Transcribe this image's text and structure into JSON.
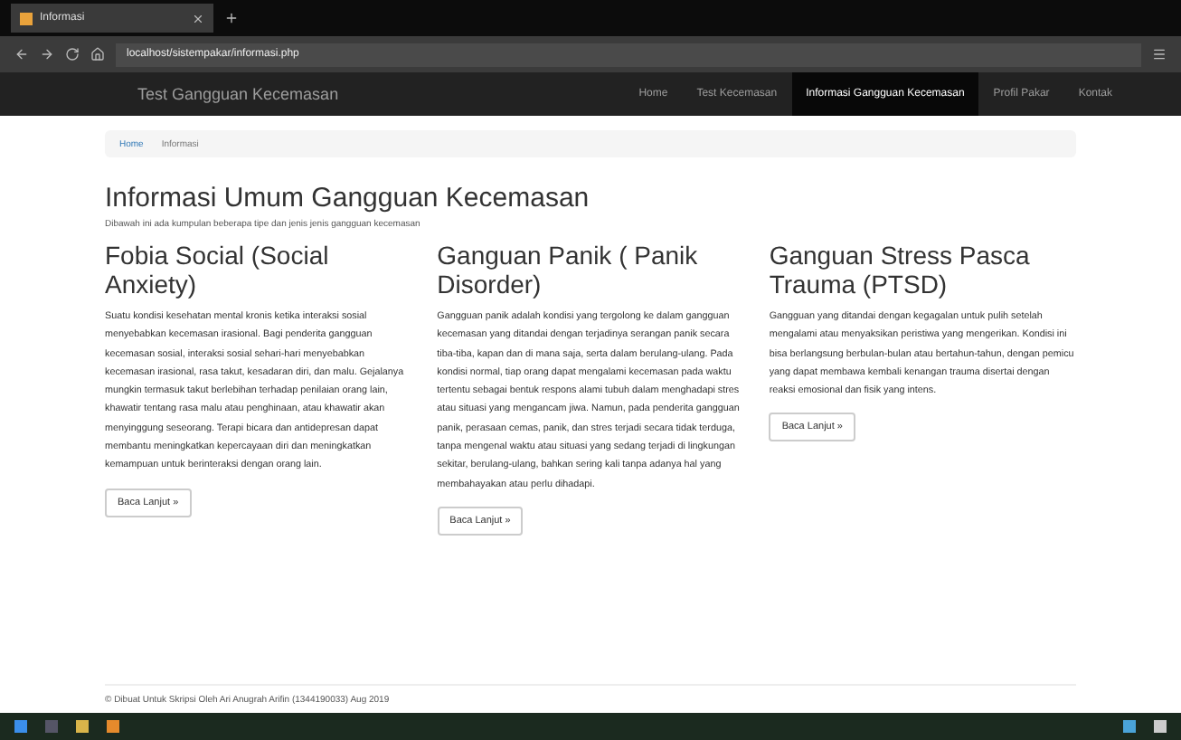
{
  "browser": {
    "tab_title": "Informasi",
    "address": "localhost/sistempakar/informasi.php"
  },
  "navbar": {
    "brand": "Test Gangguan Kecemasan",
    "items": [
      {
        "label": "Home",
        "selected": false
      },
      {
        "label": "Test Kecemasan",
        "selected": false
      },
      {
        "label": "Informasi Gangguan Kecemasan",
        "selected": true
      },
      {
        "label": "Profil Pakar",
        "selected": false
      },
      {
        "label": "Kontak",
        "selected": false
      }
    ]
  },
  "breadcrumb": [
    "Home",
    "Informasi"
  ],
  "title": "Informasi Umum Gangguan Kecemasan",
  "subtitle": "Dibawah ini ada kumpulan beberapa tipe dan jenis jenis gangguan kecemasan",
  "articles": [
    {
      "heading": "Fobia Social (Social Anxiety)",
      "body": "Suatu kondisi kesehatan mental kronis ketika interaksi sosial menyebabkan kecemasan irasional. Bagi penderita gangguan kecemasan sosial, interaksi sosial sehari-hari menyebabkan kecemasan irasional, rasa takut, kesadaran diri, dan malu. Gejalanya mungkin termasuk takut berlebihan terhadap penilaian orang lain, khawatir tentang rasa malu atau penghinaan, atau khawatir akan menyinggung seseorang. Terapi bicara dan antidepresan dapat membantu meningkatkan kepercayaan diri dan meningkatkan kemampuan untuk berinteraksi dengan orang lain.",
      "button": "Baca Lanjut »"
    },
    {
      "heading": "Ganguan Panik ( Panik Disorder)",
      "body": "Gangguan panik adalah kondisi yang tergolong ke dalam gangguan kecemasan yang ditandai dengan terjadinya serangan panik secara tiba-tiba, kapan dan di mana saja, serta dalam berulang-ulang. Pada kondisi normal, tiap orang dapat mengalami kecemasan pada waktu tertentu sebagai bentuk respons alami tubuh dalam menghadapi stres atau situasi yang mengancam jiwa. Namun, pada penderita gangguan panik, perasaan cemas, panik, dan stres terjadi secara tidak terduga, tanpa mengenal waktu atau situasi yang sedang terjadi di lingkungan sekitar, berulang-ulang, bahkan sering kali tanpa adanya hal yang membahayakan atau perlu dihadapi.",
      "button": "Baca Lanjut »"
    },
    {
      "heading": "Ganguan Stress Pasca Trauma (PTSD)",
      "body": "Gangguan yang ditandai dengan kegagalan untuk pulih setelah mengalami atau menyaksikan peristiwa yang mengerikan. Kondisi ini bisa berlangsung berbulan-bulan atau bertahun-tahun, dengan pemicu yang dapat membawa kembali kenangan trauma disertai dengan reaksi emosional dan fisik yang intens.",
      "button": "Baca Lanjut »"
    }
  ],
  "footer": "© Dibuat Untuk Skripsi Oleh Ari Anugrah Arifin (1344190033) Aug 2019"
}
